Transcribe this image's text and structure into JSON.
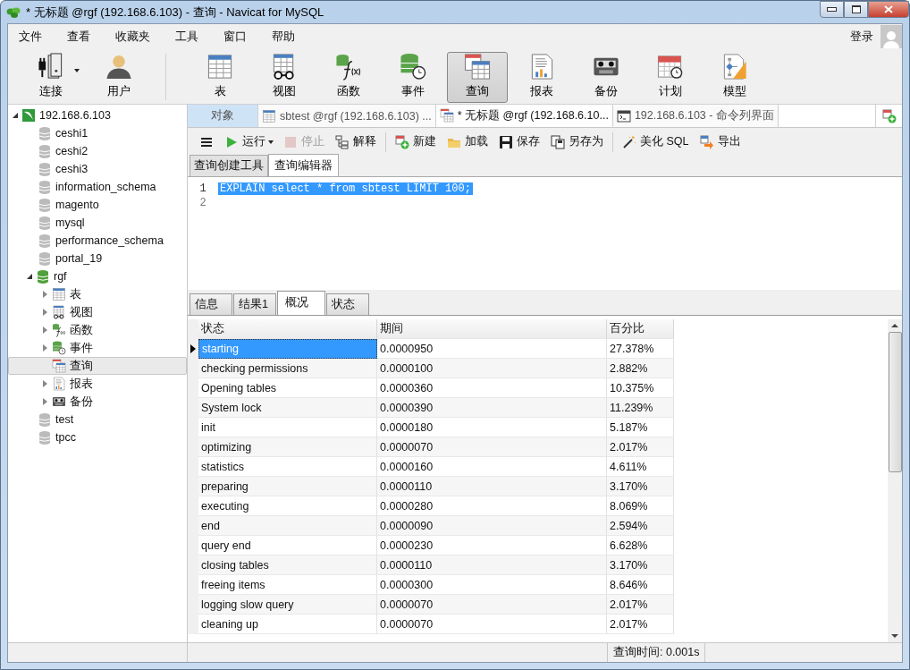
{
  "window": {
    "title": "* 无标题 @rgf (192.168.6.103) - 查询 - Navicat for MySQL"
  },
  "menu": [
    "文件",
    "查看",
    "收藏夹",
    "工具",
    "窗口",
    "帮助"
  ],
  "login": {
    "label": "登录"
  },
  "toolbar": [
    {
      "label": "连接",
      "kind": "connection",
      "selected": false,
      "dropdown": true
    },
    {
      "label": "用户",
      "kind": "user",
      "selected": false
    },
    {
      "label": "表",
      "kind": "table",
      "selected": false
    },
    {
      "label": "视图",
      "kind": "view",
      "selected": false
    },
    {
      "label": "函数",
      "kind": "function",
      "selected": false
    },
    {
      "label": "事件",
      "kind": "event",
      "selected": false
    },
    {
      "label": "查询",
      "kind": "query",
      "selected": true
    },
    {
      "label": "报表",
      "kind": "report",
      "selected": false
    },
    {
      "label": "备份",
      "kind": "backup",
      "selected": false
    },
    {
      "label": "计划",
      "kind": "schedule",
      "selected": false
    },
    {
      "label": "模型",
      "kind": "model",
      "selected": false
    }
  ],
  "sidebar": {
    "tree": [
      {
        "label": "192.168.6.103",
        "kind": "server",
        "expanded": true,
        "selected": false,
        "children": [
          {
            "label": "ceshi1",
            "kind": "database",
            "open": false,
            "selected": false
          },
          {
            "label": "ceshi2",
            "kind": "database",
            "open": false,
            "selected": false
          },
          {
            "label": "ceshi3",
            "kind": "database",
            "open": false,
            "selected": false
          },
          {
            "label": "information_schema",
            "kind": "database",
            "open": false,
            "selected": false
          },
          {
            "label": "magento",
            "kind": "database",
            "open": false,
            "selected": false
          },
          {
            "label": "mysql",
            "kind": "database",
            "open": false,
            "selected": false
          },
          {
            "label": "performance_schema",
            "kind": "database",
            "open": false,
            "selected": false
          },
          {
            "label": "portal_19",
            "kind": "database",
            "open": false,
            "selected": false
          },
          {
            "label": "rgf",
            "kind": "database",
            "open": true,
            "expanded": true,
            "selected": false,
            "children": [
              {
                "label": "表",
                "kind": "table",
                "expanded": false,
                "selected": false
              },
              {
                "label": "视图",
                "kind": "view",
                "expanded": false,
                "selected": false
              },
              {
                "label": "函数",
                "kind": "function",
                "expanded": false,
                "selected": false
              },
              {
                "label": "事件",
                "kind": "event",
                "expanded": false,
                "selected": false
              },
              {
                "label": "查询",
                "kind": "query",
                "selected": true
              },
              {
                "label": "报表",
                "kind": "report",
                "expanded": false,
                "selected": false
              },
              {
                "label": "备份",
                "kind": "backup",
                "expanded": false,
                "selected": false
              }
            ]
          },
          {
            "label": "test",
            "kind": "database",
            "open": false,
            "selected": false
          },
          {
            "label": "tpcc",
            "kind": "database",
            "open": false,
            "selected": false
          }
        ]
      }
    ]
  },
  "object_tabs": [
    {
      "label": "对象",
      "kind": "objects",
      "selected": false
    },
    {
      "label": "sbtest @rgf (192.168.6.103) ...",
      "kind": "table",
      "selected": false
    },
    {
      "label": "* 无标题 @rgf (192.168.6.10...",
      "kind": "query",
      "selected": true
    },
    {
      "label": "192.168.6.103 - 命令列界面",
      "kind": "console",
      "selected": false
    }
  ],
  "query_toolbar": [
    {
      "kind": "menu",
      "disabled": false
    },
    {
      "label": "运行",
      "kind": "run",
      "disabled": false,
      "dropdown": true
    },
    {
      "label": "停止",
      "kind": "stop",
      "disabled": true
    },
    {
      "label": "解释",
      "kind": "explain",
      "disabled": false
    },
    {
      "label": "新建",
      "kind": "new",
      "disabled": false
    },
    {
      "label": "加载",
      "kind": "load",
      "disabled": false
    },
    {
      "label": "保存",
      "kind": "save",
      "disabled": false
    },
    {
      "label": "另存为",
      "kind": "saveas",
      "disabled": false
    },
    {
      "label": "美化 SQL",
      "kind": "beautify",
      "disabled": false
    },
    {
      "label": "导出",
      "kind": "export",
      "disabled": false
    }
  ],
  "editor_tabs": [
    {
      "label": "查询创建工具",
      "selected": false
    },
    {
      "label": "查询编辑器",
      "selected": true
    }
  ],
  "editor": {
    "lines": [
      {
        "number": "1",
        "code": "EXPLAIN select * from sbtest LIMIT 100;",
        "selected": true
      },
      {
        "number": "2",
        "selected": false
      }
    ]
  },
  "result_tabs": [
    {
      "label": "信息",
      "selected": false
    },
    {
      "label": "结果1",
      "selected": false
    },
    {
      "label": "概况",
      "selected": true
    },
    {
      "label": "状态",
      "selected": false
    }
  ],
  "table": {
    "columns": [
      "状态",
      "期间",
      "百分比"
    ],
    "rows": [
      {
        "cells": [
          "starting",
          "0.0000950",
          "27.378%"
        ],
        "selected": true
      },
      {
        "cells": [
          "checking permissions",
          "0.0000100",
          "2.882%"
        ],
        "selected": false
      },
      {
        "cells": [
          "Opening tables",
          "0.0000360",
          "10.375%"
        ],
        "selected": false
      },
      {
        "cells": [
          "System lock",
          "0.0000390",
          "11.239%"
        ],
        "selected": false
      },
      {
        "cells": [
          "init",
          "0.0000180",
          "5.187%"
        ],
        "selected": false
      },
      {
        "cells": [
          "optimizing",
          "0.0000070",
          "2.017%"
        ],
        "selected": false
      },
      {
        "cells": [
          "statistics",
          "0.0000160",
          "4.611%"
        ],
        "selected": false
      },
      {
        "cells": [
          "preparing",
          "0.0000110",
          "3.170%"
        ],
        "selected": false
      },
      {
        "cells": [
          "executing",
          "0.0000280",
          "8.069%"
        ],
        "selected": false
      },
      {
        "cells": [
          "end",
          "0.0000090",
          "2.594%"
        ],
        "selected": false
      },
      {
        "cells": [
          "query end",
          "0.0000230",
          "6.628%"
        ],
        "selected": false
      },
      {
        "cells": [
          "closing tables",
          "0.0000110",
          "3.170%"
        ],
        "selected": false
      },
      {
        "cells": [
          "freeing items",
          "0.0000300",
          "8.646%"
        ],
        "selected": false
      },
      {
        "cells": [
          "logging slow query",
          "0.0000070",
          "2.017%"
        ],
        "selected": false
      },
      {
        "cells": [
          "cleaning up",
          "0.0000070",
          "2.017%"
        ],
        "selected": false
      }
    ]
  },
  "status_bar": {
    "query_time": "查询时间: 0.001s"
  }
}
